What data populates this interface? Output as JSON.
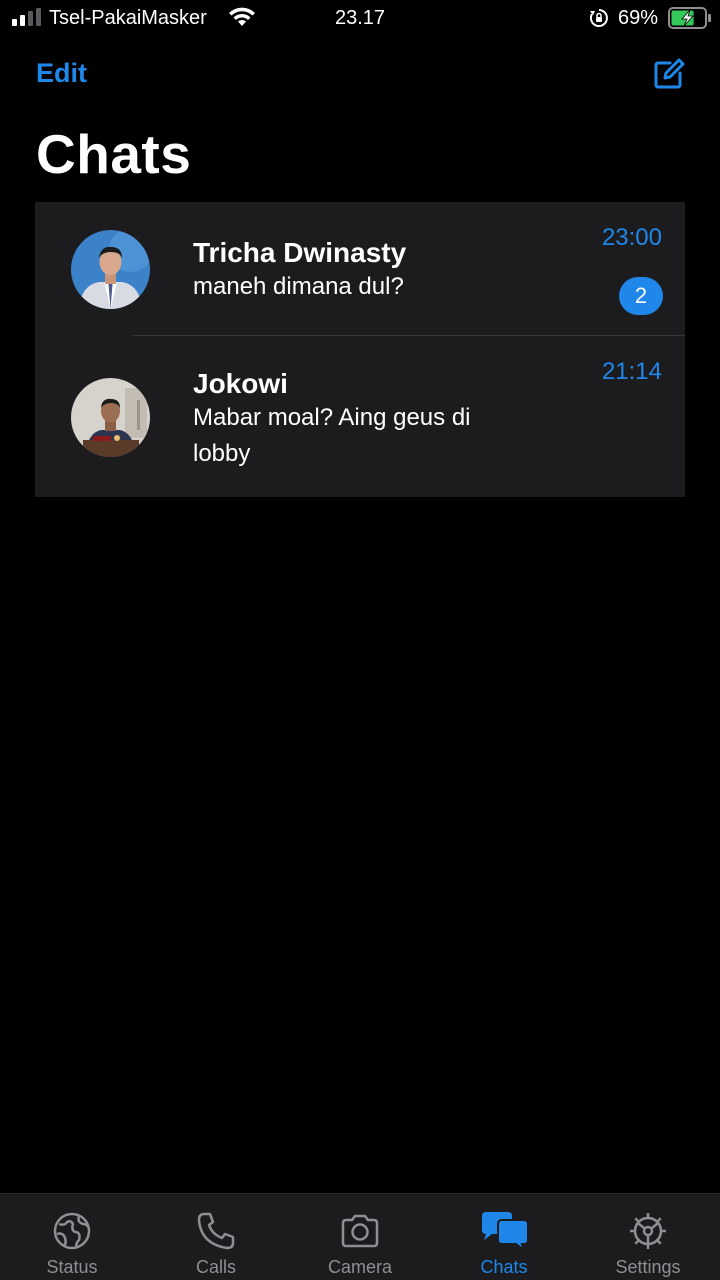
{
  "status_bar": {
    "carrier": "Tsel-PakaiMasker",
    "time": "23.17",
    "battery_percent": "69%",
    "battery_level": 0.69
  },
  "header": {
    "edit_label": "Edit",
    "compose_icon": "compose-icon",
    "title": "Chats"
  },
  "chats": [
    {
      "name": "Tricha Dwinasty",
      "message": "maneh dimana dul?",
      "time": "23:00",
      "unread": "2"
    },
    {
      "name": "Jokowi",
      "message": "Mabar moal? Aing geus di lobby",
      "time": "21:14"
    }
  ],
  "tabs": [
    {
      "label": "Status",
      "icon": "status-icon"
    },
    {
      "label": "Calls",
      "icon": "phone-icon"
    },
    {
      "label": "Camera",
      "icon": "camera-icon"
    },
    {
      "label": "Chats",
      "icon": "chats-icon",
      "active": true
    },
    {
      "label": "Settings",
      "icon": "gear-icon"
    }
  ],
  "colors": {
    "accent": "#1f87ea",
    "background": "#000000",
    "list_background": "#1c1c1e",
    "inactive_tab": "#8e8e93",
    "battery_charging": "#34c759"
  }
}
